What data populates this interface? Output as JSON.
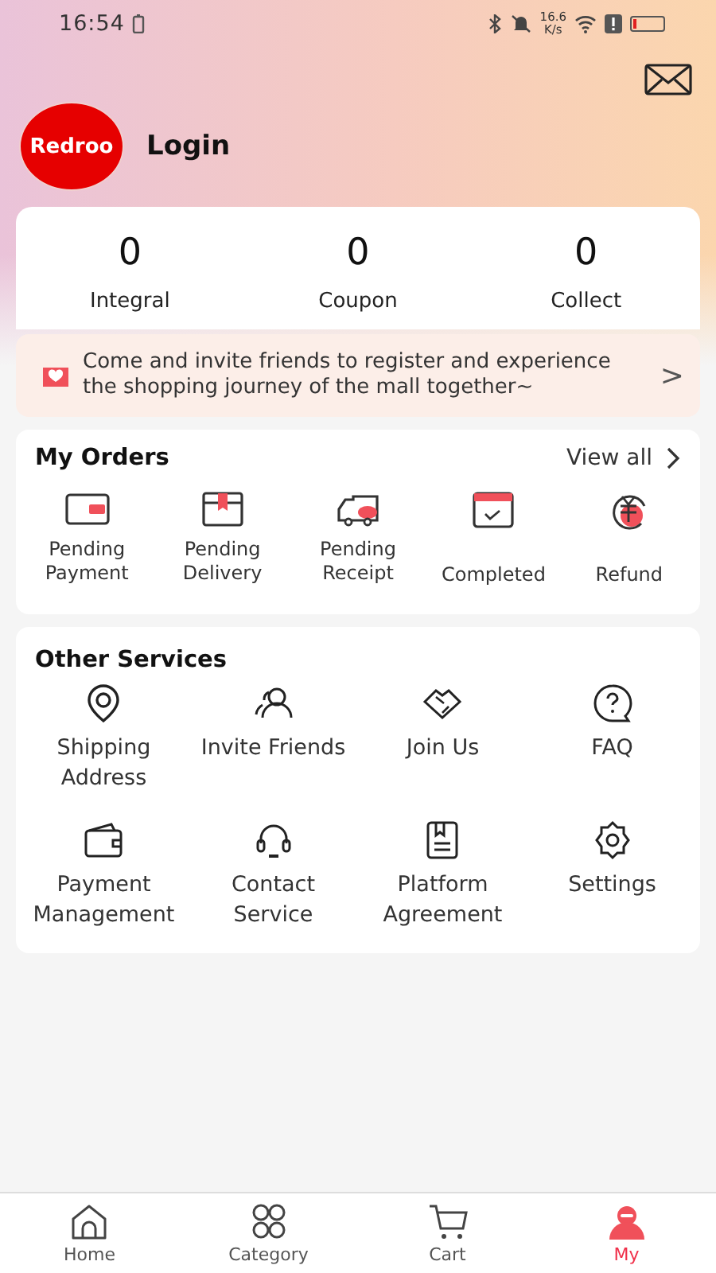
{
  "status_bar": {
    "time": "16:54",
    "speed": "16.6",
    "speed_unit": "K/s"
  },
  "profile": {
    "logo": "Redroo",
    "login": "Login"
  },
  "stats": [
    {
      "value": "0",
      "label": "Integral"
    },
    {
      "value": "0",
      "label": "Coupon"
    },
    {
      "value": "0",
      "label": "Collect"
    }
  ],
  "invite_banner": {
    "text": "Come and invite friends to register and experience the shopping journey of the mall together~",
    "arrow": ">"
  },
  "orders": {
    "title": "My Orders",
    "view_all": "View all",
    "items": [
      {
        "label": "Pending Payment"
      },
      {
        "label": "Pending Delivery"
      },
      {
        "label": "Pending Receipt"
      },
      {
        "label": "Completed"
      },
      {
        "label": "Refund"
      }
    ]
  },
  "services": {
    "title": "Other Services",
    "items": [
      {
        "label": "Shipping Address"
      },
      {
        "label": "Invite Friends"
      },
      {
        "label": "Join Us"
      },
      {
        "label": "FAQ"
      },
      {
        "label": "Payment Management"
      },
      {
        "label": "Contact Service"
      },
      {
        "label": "Platform Agreement"
      },
      {
        "label": "Settings"
      }
    ]
  },
  "tab_bar": [
    {
      "label": "Home",
      "selected": false
    },
    {
      "label": "Category",
      "selected": false
    },
    {
      "label": "Cart",
      "selected": false
    },
    {
      "label": "My",
      "selected": true
    }
  ]
}
